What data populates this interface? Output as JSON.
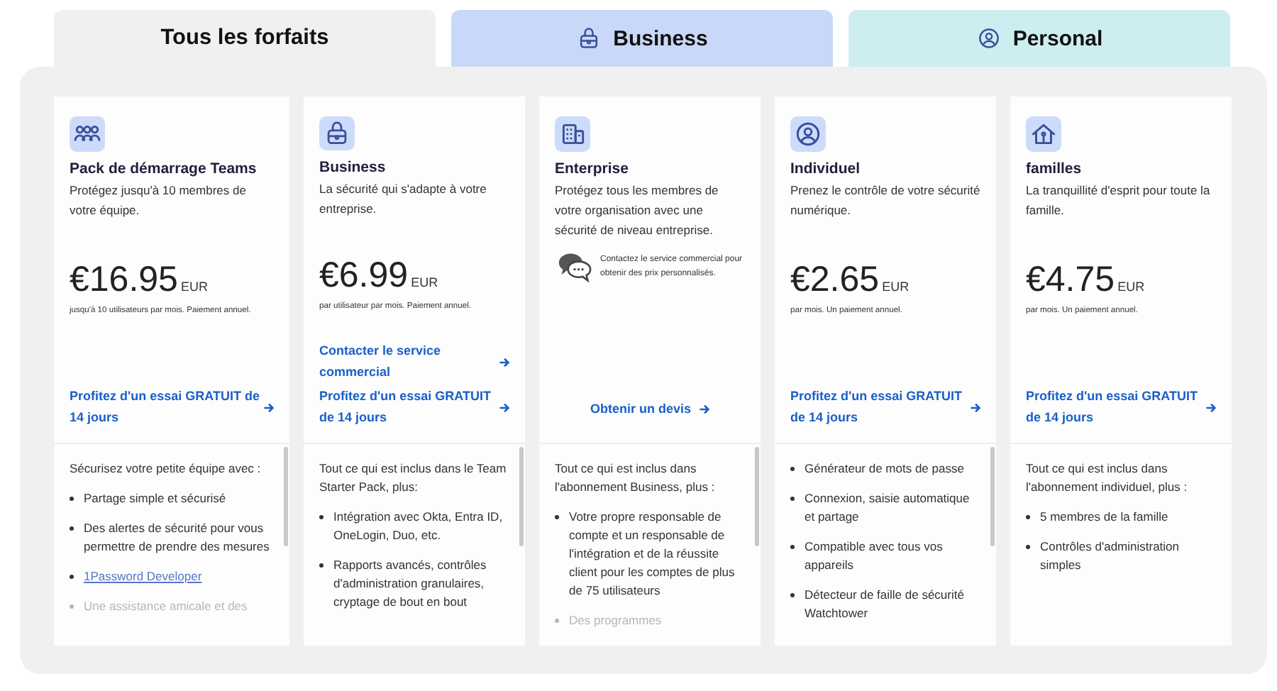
{
  "tabs": [
    {
      "label": "Tous les forfaits",
      "selected": true,
      "color": "#f0f0f0"
    },
    {
      "label": "Business",
      "selected": false,
      "color": "#c9d8f8"
    },
    {
      "label": "Personal",
      "selected": false,
      "color": "#cdeef0"
    }
  ],
  "plans": [
    {
      "title": "Pack de démarrage Teams",
      "description": "Protégez jusqu'à 10 membres de votre équipe.",
      "pricing": {
        "kind": "price",
        "amount": "€16.95",
        "currency": "EUR",
        "note": "jusqu'à 10 utilisateurs par mois. Paiement annuel."
      },
      "actions": [
        {
          "kind": "link",
          "label": "Profitez d'un essai GRATUIT de 14 jours"
        }
      ],
      "features_intro": "Sécurisez votre petite équipe avec :",
      "features": [
        {
          "kind": "text",
          "text": "Partage simple et sécurisé",
          "faded": false
        },
        {
          "kind": "text",
          "text": "Des alertes de sécurité pour vous permettre de prendre des mesures",
          "faded": false
        },
        {
          "kind": "link",
          "text": "1Password Developer",
          "faded": false
        },
        {
          "kind": "text",
          "text": "Une assistance amicale et des",
          "faded": true
        }
      ]
    },
    {
      "title": "Business",
      "description": "La sécurité qui s'adapte à votre entreprise.",
      "pricing": {
        "kind": "price",
        "amount": "€6.99",
        "currency": "EUR",
        "note": "par utilisateur par mois. Paiement annuel."
      },
      "actions": [
        {
          "kind": "link",
          "label": "Contacter le service commercial"
        },
        {
          "kind": "link",
          "label": "Profitez d'un essai GRATUIT de 14 jours"
        }
      ],
      "features_intro": "Tout ce qui est inclus dans le Team Starter Pack, plus:",
      "features": [
        {
          "kind": "text",
          "text": "Intégration avec Okta, Entra ID, OneLogin, Duo, etc.",
          "faded": false
        },
        {
          "kind": "text",
          "text": "Rapports avancés, contrôles d'administration granulaires, cryptage de bout en bout",
          "faded": false
        }
      ]
    },
    {
      "title": "Enterprise",
      "description": "Protégez tous les membres de votre organisation avec une sécurité de niveau entreprise.",
      "pricing": {
        "kind": "contact",
        "note": "Contactez le service commercial pour obtenir des prix personnalisés."
      },
      "actions": [
        {
          "kind": "centered",
          "label": "Obtenir un devis"
        }
      ],
      "features_intro": "Tout ce qui est inclus dans l'abonnement Business, plus :",
      "features": [
        {
          "kind": "text",
          "text": "Votre propre responsable de compte et un responsable de l'intégration et de la réussite client pour les comptes de plus de 75 utilisateurs",
          "faded": false
        },
        {
          "kind": "text",
          "text": "Des programmes",
          "faded": true
        }
      ]
    },
    {
      "title": "Individuel",
      "description": "Prenez le contrôle de votre sécurité numérique.",
      "pricing": {
        "kind": "price",
        "amount": "€2.65",
        "currency": "EUR",
        "note": "par mois. Un paiement annuel."
      },
      "actions": [
        {
          "kind": "link",
          "label": "Profitez d'un essai GRATUIT de 14 jours"
        }
      ],
      "features": [
        {
          "kind": "text",
          "text": "Générateur de mots de passe",
          "faded": false
        },
        {
          "kind": "text",
          "text": "Connexion, saisie automatique et partage",
          "faded": false
        },
        {
          "kind": "text",
          "text": "Compatible avec tous vos appareils",
          "faded": false
        },
        {
          "kind": "text",
          "text": "Détecteur de faille de sécurité Watchtower",
          "faded": false
        }
      ]
    },
    {
      "title": "familles",
      "description": "La tranquillité d'esprit pour toute la famille.",
      "pricing": {
        "kind": "price",
        "amount": "€4.75",
        "currency": "EUR",
        "note": "par mois. Un paiement annuel."
      },
      "actions": [
        {
          "kind": "link",
          "label": "Profitez d'un essai GRATUIT de 14 jours"
        }
      ],
      "features_intro": "Tout ce qui est inclus dans l'abonnement individuel, plus :",
      "features": [
        {
          "kind": "text",
          "text": "5 membres de la famille",
          "faded": false
        },
        {
          "kind": "text",
          "text": "Contrôles d'administration simples",
          "faded": false
        }
      ]
    }
  ]
}
